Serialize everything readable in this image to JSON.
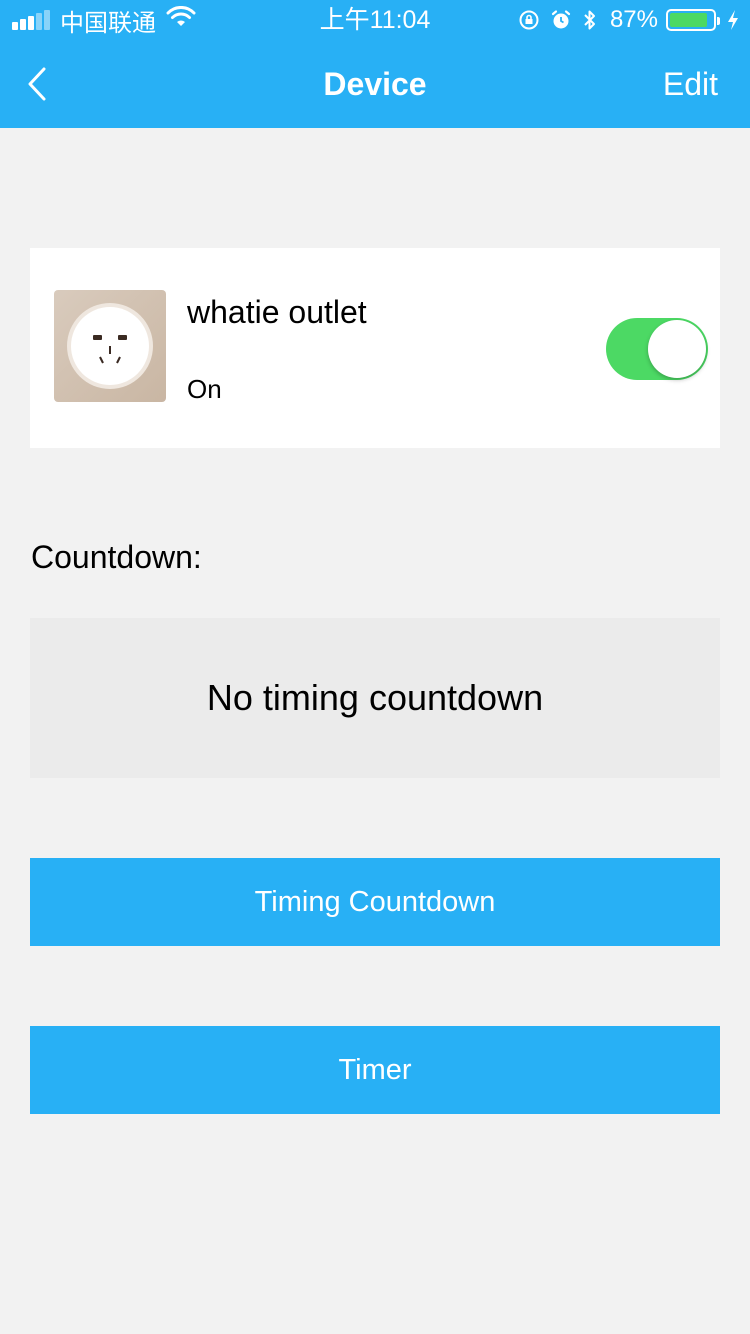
{
  "status_bar": {
    "carrier": "中国联通",
    "time": "上午11:04",
    "battery_percent": "87%",
    "battery_level": 0.87,
    "icons": [
      "signal-icon",
      "wifi-icon",
      "orientation-lock-icon",
      "alarm-icon",
      "bluetooth-icon",
      "battery-icon",
      "charging-icon"
    ]
  },
  "nav": {
    "back_icon": "chevron-left-icon",
    "title": "Device",
    "edit_label": "Edit"
  },
  "device": {
    "name": "whatie outlet",
    "state": "On",
    "toggle_on": true,
    "image_icon": "power-outlet-icon"
  },
  "countdown": {
    "label": "Countdown:",
    "empty_text": "No timing countdown"
  },
  "buttons": {
    "timing_countdown": "Timing Countdown",
    "timer": "Timer"
  },
  "colors": {
    "accent": "#28b0f5",
    "toggle_on": "#4cd964",
    "background": "#f2f2f2"
  }
}
